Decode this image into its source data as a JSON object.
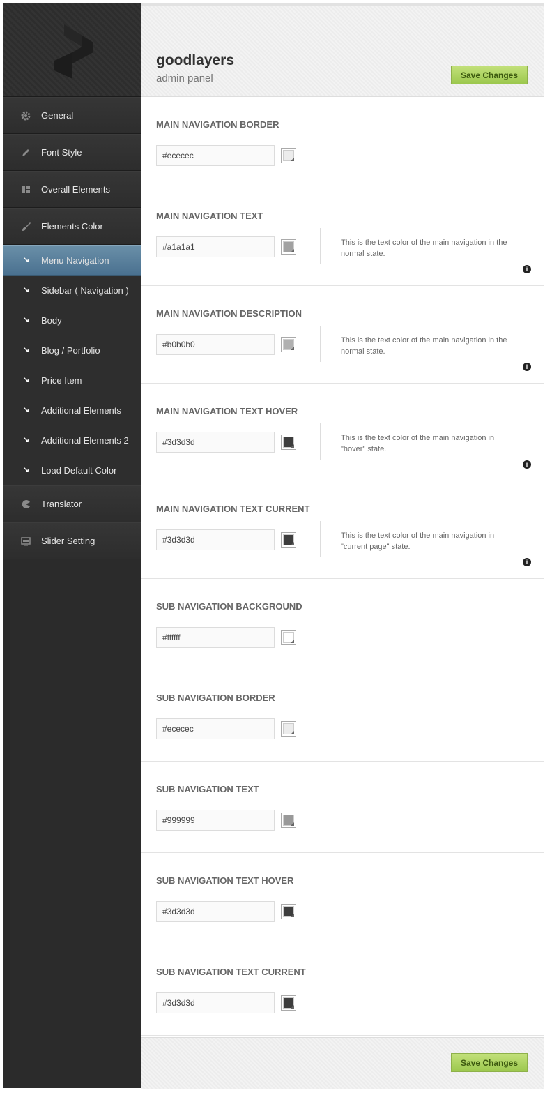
{
  "header": {
    "brand": "goodlayers",
    "subtitle": "admin panel",
    "save_label": "Save Changes"
  },
  "footer": {
    "save_label": "Save Changes"
  },
  "sidebar": {
    "main_items": [
      {
        "label": "General",
        "icon": "gear-icon"
      },
      {
        "label": "Font Style",
        "icon": "pencil-icon"
      },
      {
        "label": "Overall Elements",
        "icon": "layout-icon"
      },
      {
        "label": "Elements Color",
        "icon": "brush-icon"
      }
    ],
    "sub_items": [
      {
        "label": "Menu Navigation",
        "active": true
      },
      {
        "label": "Sidebar ( Navigation )"
      },
      {
        "label": "Body"
      },
      {
        "label": "Blog / Portfolio"
      },
      {
        "label": "Price Item"
      },
      {
        "label": "Additional Elements"
      },
      {
        "label": "Additional Elements 2"
      },
      {
        "label": "Load Default Color"
      }
    ],
    "bottom_items": [
      {
        "label": "Translator",
        "icon": "pacman-icon"
      },
      {
        "label": "Slider Setting",
        "icon": "slider-icon"
      }
    ]
  },
  "sections": [
    {
      "title": "MAIN NAVIGATION BORDER",
      "value": "#ececec",
      "color": "#ececec"
    },
    {
      "title": "MAIN NAVIGATION TEXT",
      "value": "#a1a1a1",
      "color": "#a1a1a1",
      "desc": "This is the text color of the main navigation in the normal state."
    },
    {
      "title": "MAIN NAVIGATION DESCRIPTION",
      "value": "#b0b0b0",
      "color": "#b0b0b0",
      "desc": "This is the text color of the main navigation in the normal state."
    },
    {
      "title": "MAIN NAVIGATION TEXT HOVER",
      "value": "#3d3d3d",
      "color": "#3d3d3d",
      "desc": "This is the text color of the main navigation in \"hover\" state."
    },
    {
      "title": "MAIN NAVIGATION TEXT CURRENT",
      "value": "#3d3d3d",
      "color": "#3d3d3d",
      "desc": "This is the text color of the main navigation in \"current page\" state."
    },
    {
      "title": "SUB NAVIGATION BACKGROUND",
      "value": "#ffffff",
      "color": "#ffffff"
    },
    {
      "title": "SUB NAVIGATION BORDER",
      "value": "#ececec",
      "color": "#ececec"
    },
    {
      "title": "SUB NAVIGATION TEXT",
      "value": "#999999",
      "color": "#999999"
    },
    {
      "title": "SUB NAVIGATION TEXT HOVER",
      "value": "#3d3d3d",
      "color": "#3d3d3d"
    },
    {
      "title": "SUB NAVIGATION TEXT CURRENT",
      "value": "#3d3d3d",
      "color": "#3d3d3d"
    }
  ],
  "info_icon": "i"
}
